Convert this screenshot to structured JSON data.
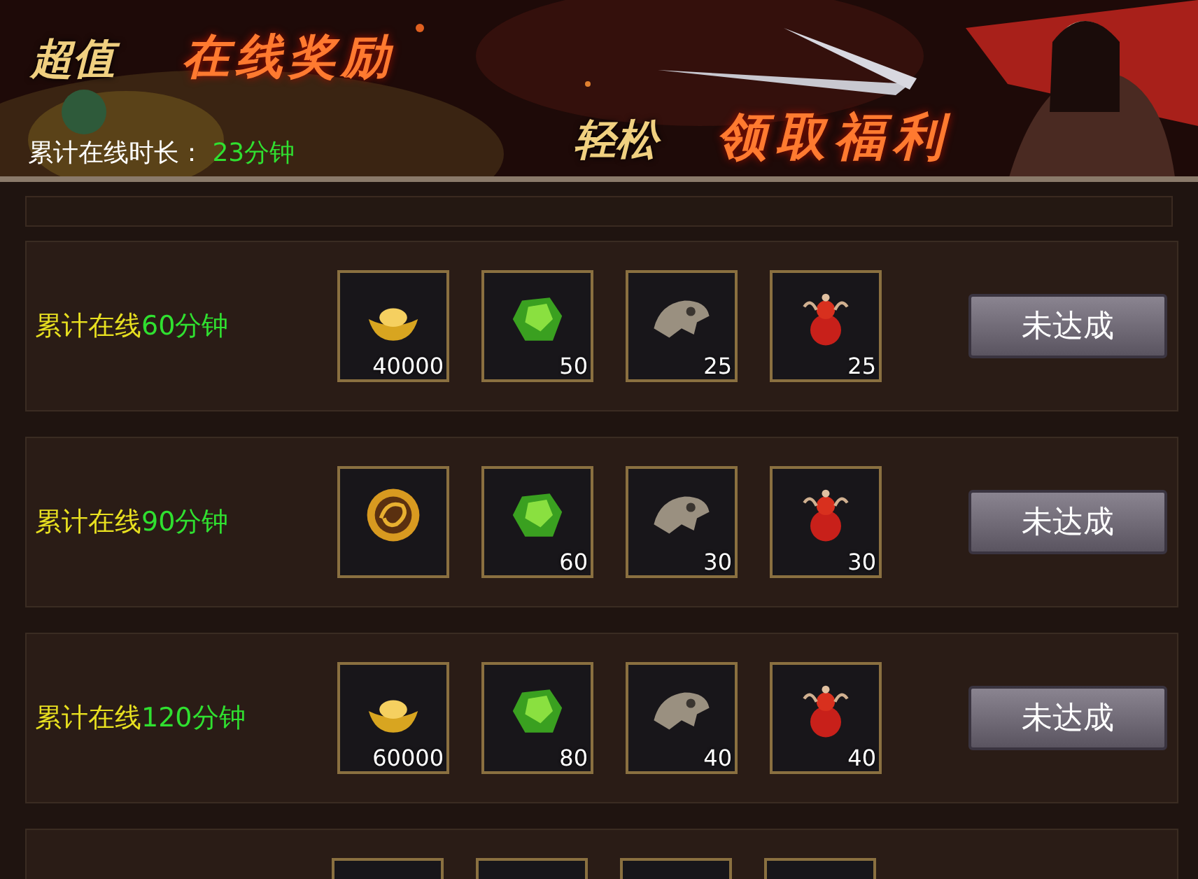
{
  "banner": {
    "title_left_a": "超值",
    "title_left_b": "在线奖励",
    "title_right_a": "轻松",
    "title_right_b": "领取福利",
    "online_label": "累计在线时长：",
    "online_time": "23分钟"
  },
  "rows": [
    {
      "label": "累计在线",
      "time": "60分钟",
      "items": [
        {
          "kind": "ingot",
          "count": "40000"
        },
        {
          "kind": "gem",
          "count": "50"
        },
        {
          "kind": "fossil",
          "count": "25"
        },
        {
          "kind": "gourd",
          "count": "25"
        }
      ],
      "button": "未达成"
    },
    {
      "label": "累计在线",
      "time": "90分钟",
      "items": [
        {
          "kind": "medal"
        },
        {
          "kind": "gem",
          "count": "60"
        },
        {
          "kind": "fossil",
          "count": "30"
        },
        {
          "kind": "gourd",
          "count": "30"
        }
      ],
      "button": "未达成"
    },
    {
      "label": "累计在线",
      "time": "120分钟",
      "items": [
        {
          "kind": "ingot",
          "count": "60000"
        },
        {
          "kind": "gem",
          "count": "80"
        },
        {
          "kind": "fossil",
          "count": "40"
        },
        {
          "kind": "gourd",
          "count": "40"
        }
      ],
      "button": "未达成"
    }
  ]
}
